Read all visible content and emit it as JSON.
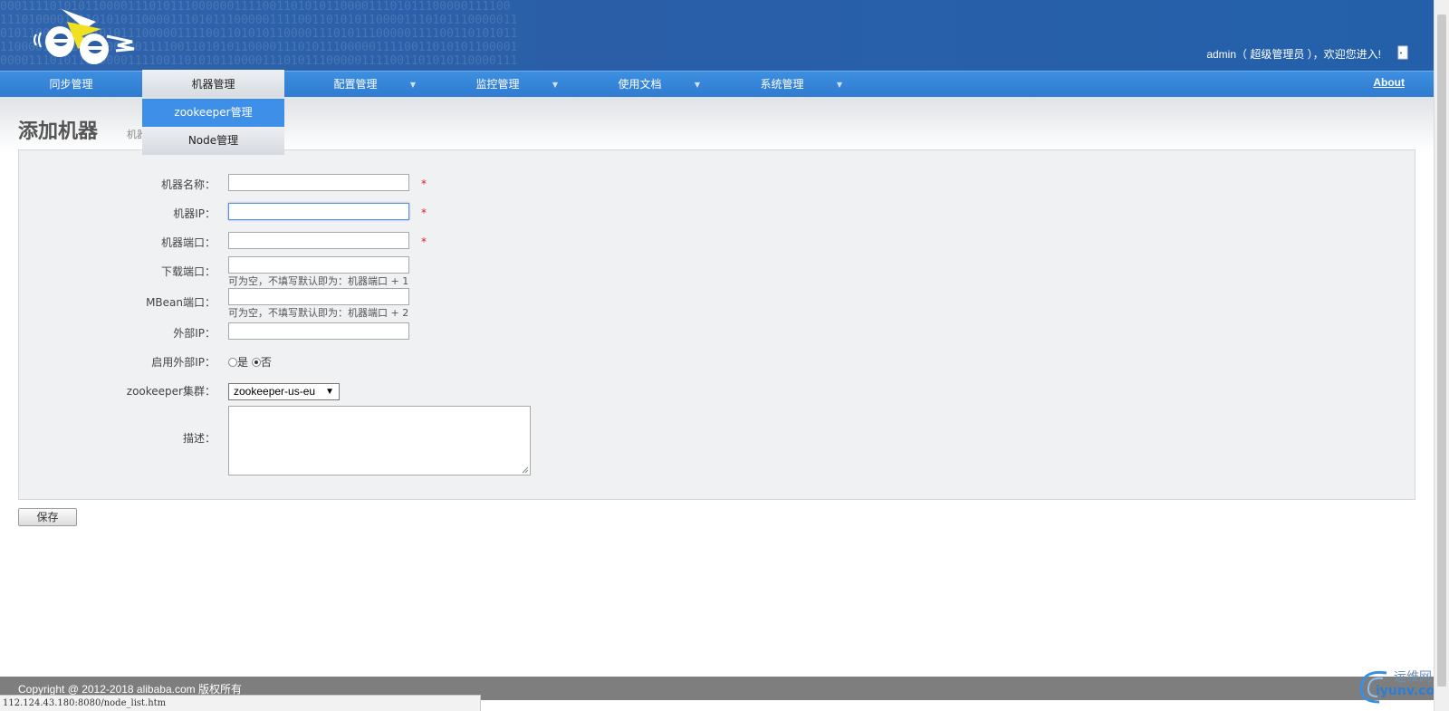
{
  "header": {
    "binary_text": [
      "000111101010110000111010111000000111100110101011000011101011100000111100",
      "1110100001111010101100001110101110000011110011010101100001110101110000011",
      "0101100001110101011100000111100110101011000011101011100000111100110101011",
      "1100001110101110000011110011010101100001110101110000011110011010101100001",
      "0000111010111000001111001101010110000111010111000001111001101010110000111"
    ],
    "user_info": "admin（ 超级管理员 ），欢迎您进入!"
  },
  "nav": {
    "items": [
      {
        "label": "同步管理"
      },
      {
        "label": "机器管理"
      },
      {
        "label": "配置管理"
      },
      {
        "label": "监控管理"
      },
      {
        "label": "使用文档"
      },
      {
        "label": "系统管理"
      }
    ],
    "arrow": "▼",
    "about": "About",
    "dropdown": [
      {
        "label": "zookeeper管理"
      },
      {
        "label": "Node管理"
      }
    ]
  },
  "page": {
    "title": "添加机器",
    "breadcrumb": "机器"
  },
  "form": {
    "required_mark": "*",
    "machine_name_label": "机器名称：",
    "machine_name_value": "",
    "machine_ip_label": "机器IP：",
    "machine_ip_value": "",
    "machine_port_label": "机器端口：",
    "machine_port_value": "",
    "download_port_label": "下载端口：",
    "download_port_value": "",
    "download_port_hint": "可为空，不填写默认即为：机器端口 + 1",
    "mbean_port_label": "MBean端口：",
    "mbean_port_value": "",
    "mbean_port_hint": "可为空，不填写默认即为：机器端口 + 2",
    "external_ip_label": "外部IP：",
    "external_ip_value": "",
    "enable_external_ip_label": "启用外部IP：",
    "radio_yes": "是",
    "radio_no": "否",
    "radio_selected": "否",
    "zk_cluster_label": "zookeeper集群：",
    "zk_cluster_value": "zookeeper-us-eu",
    "description_label": "描述：",
    "description_value": "",
    "save_button": "保存"
  },
  "footer": {
    "copyright": "Copyright @ 2012-2018  alibaba.com  版权所有"
  },
  "status_bar": {
    "url": "112.124.43.180:8080/node_list.htm"
  },
  "watermark": {
    "text_cn": "运维网",
    "text_en": "iyunv.com"
  },
  "colors": {
    "header_blue": "#2a5fa8",
    "nav_blue": "#3a8be0",
    "dropdown_highlight": "#3d8fe8",
    "required_red": "#e02020",
    "footer_gray": "#7e7e7e"
  },
  "icons": {
    "logo": "ete-logo",
    "logout": "door-icon",
    "dropdown_arrow": "triangle-down-icon"
  }
}
